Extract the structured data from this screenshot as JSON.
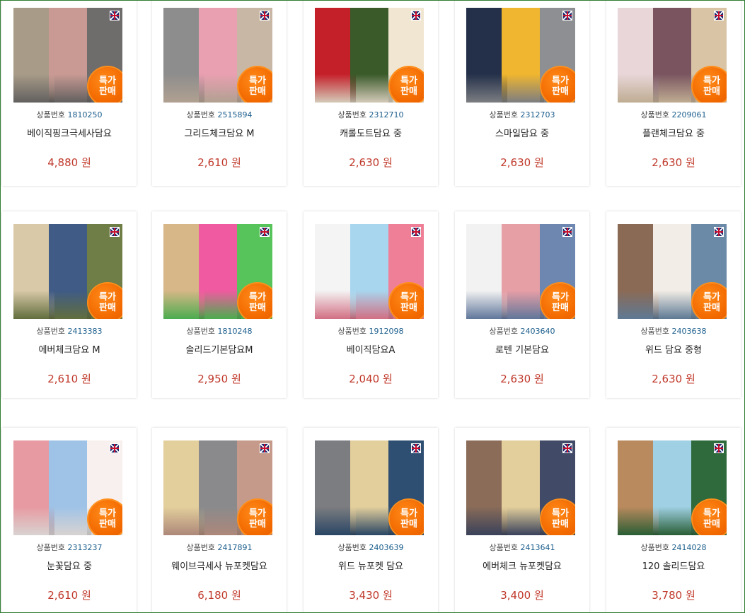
{
  "badge_line1": "특가",
  "badge_line2": "판매",
  "code_label": "상품번호",
  "products": [
    {
      "code": "1810250",
      "name": "베이직핑크극세사담요",
      "price": "4,880 원",
      "colors": [
        "#a89b88",
        "#c99a94",
        "#6f6d6c"
      ]
    },
    {
      "code": "2515894",
      "name": "그리드체크담요 M",
      "price": "2,610 원",
      "colors": [
        "#8d8d8d",
        "#e9a0b1",
        "#c9b7a5"
      ]
    },
    {
      "code": "2312710",
      "name": "캐롤도트담요 중",
      "price": "2,630 원",
      "colors": [
        "#c4202a",
        "#3a5a2a",
        "#f1e6d2"
      ]
    },
    {
      "code": "2312703",
      "name": "스마일담요 중",
      "price": "2,630 원",
      "colors": [
        "#24304a",
        "#f0b62f",
        "#8d8f93"
      ]
    },
    {
      "code": "2209061",
      "name": "플랜체크담요 중",
      "price": "2,630 원",
      "colors": [
        "#e8d6d9",
        "#7a5560",
        "#d9c4a6"
      ]
    },
    {
      "code": "2413383",
      "name": "에버체크담요 M",
      "price": "2,610 원",
      "colors": [
        "#d9c9a8",
        "#3f5b86",
        "#6f7d46"
      ]
    },
    {
      "code": "1810248",
      "name": "솔리드기본담요M",
      "price": "2,950 원",
      "colors": [
        "#d7b787",
        "#f05aa0",
        "#56c45a"
      ]
    },
    {
      "code": "1912098",
      "name": "베이직담요A",
      "price": "2,040 원",
      "colors": [
        "#f4f4f4",
        "#a8d6ef",
        "#ef7f96"
      ]
    },
    {
      "code": "2403640",
      "name": "로텐 기본담요",
      "price": "2,630 원",
      "colors": [
        "#f2f2f2",
        "#e79fa6",
        "#6e87b0"
      ]
    },
    {
      "code": "2403638",
      "name": "위드 담요 중형",
      "price": "2,630 원",
      "colors": [
        "#8b6a55",
        "#f2ede6",
        "#6b8aa8"
      ]
    },
    {
      "code": "2313237",
      "name": "눈꽃담요 중",
      "price": "2,610 원",
      "colors": [
        "#e79aa1",
        "#9fc3e7",
        "#f7f0ee"
      ]
    },
    {
      "code": "2417891",
      "name": "웨이브극세사 뉴포켓담요",
      "price": "6,180 원",
      "colors": [
        "#e3cf9c",
        "#8a8a8c",
        "#c59a8a"
      ]
    },
    {
      "code": "2403639",
      "name": "위드 뉴포켓 담요",
      "price": "3,430 원",
      "colors": [
        "#7c7d80",
        "#e3cf9c",
        "#2f4f72"
      ]
    },
    {
      "code": "2413641",
      "name": "에버체크 뉴포켓담요",
      "price": "3,400 원",
      "colors": [
        "#8a6c58",
        "#e3cf9c",
        "#414a67"
      ]
    },
    {
      "code": "2414028",
      "name": "120 솔리드담요",
      "price": "3,780 원",
      "colors": [
        "#b98a5e",
        "#9fd0e3",
        "#2f6a3c"
      ]
    }
  ]
}
